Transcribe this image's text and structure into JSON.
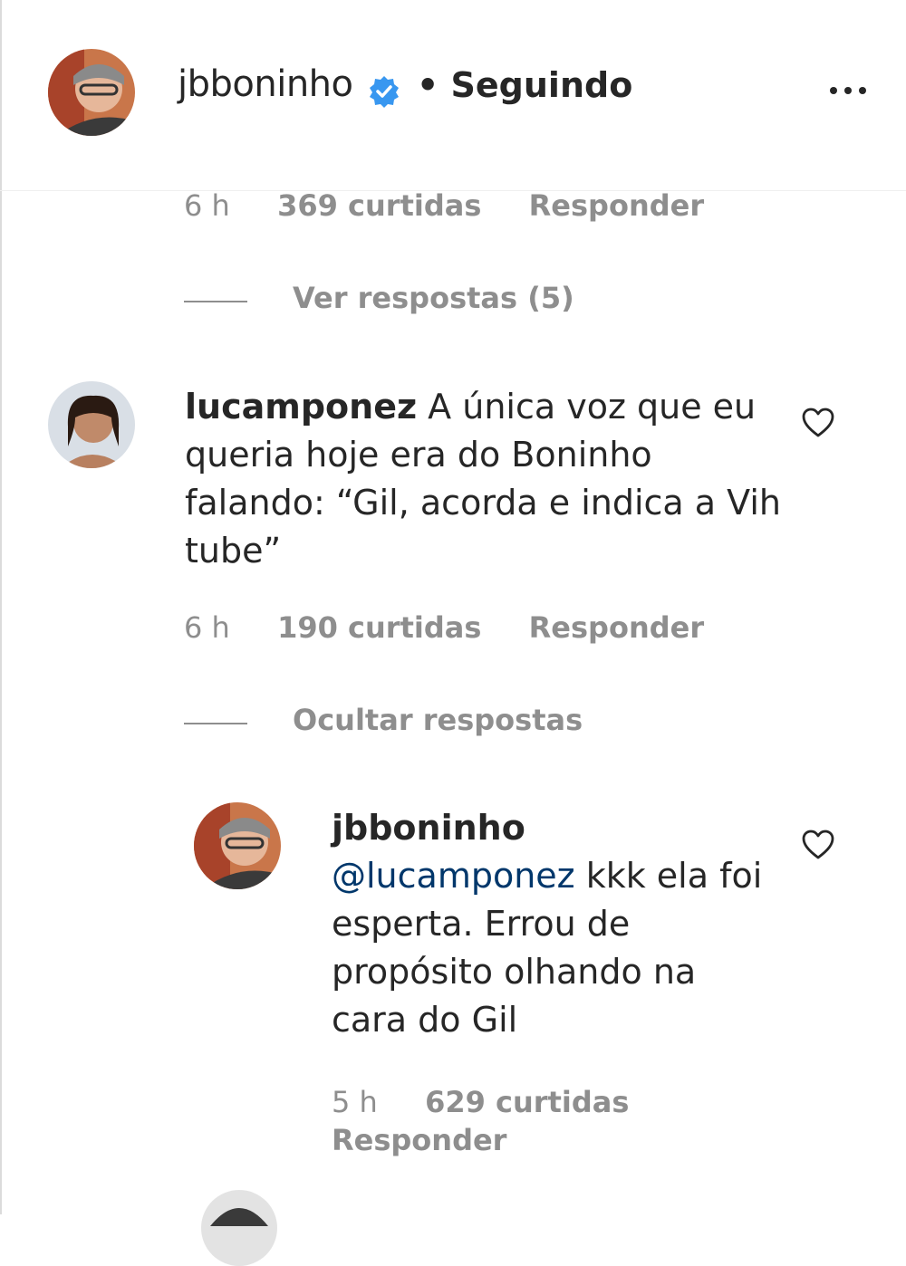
{
  "header": {
    "username": "jbboninho",
    "follow_status": "• Seguindo",
    "more_icon": "more-icon",
    "verified_icon": "verified-badge-icon"
  },
  "comment_top": {
    "time": "6 h",
    "likes": "369 curtidas",
    "reply_label": "Responder",
    "view_replies": "Ver respostas (5)"
  },
  "comment_1": {
    "username": "lucamponez",
    "text_lines": [
      " A única voz que eu",
      "queria hoje era do Boninho",
      "falando: “Gil, acorda e indica a Vih",
      "tube”"
    ],
    "time": "6 h",
    "likes": "190 curtidas",
    "reply_label": "Responder",
    "hide_replies": "Ocultar respostas"
  },
  "reply_1": {
    "username": "jbboninho",
    "mention": "@lucamponez",
    "text_lines": [
      " kkk ela foi",
      "esperta. Errou de",
      "propósito olhando na",
      "cara do Gil"
    ],
    "time": "5 h",
    "likes": "629 curtidas",
    "reply_label": "Responder"
  },
  "colors": {
    "text": "#262626",
    "secondary": "#8e8e8e",
    "mention": "#00376b",
    "verified": "#3897f0"
  }
}
